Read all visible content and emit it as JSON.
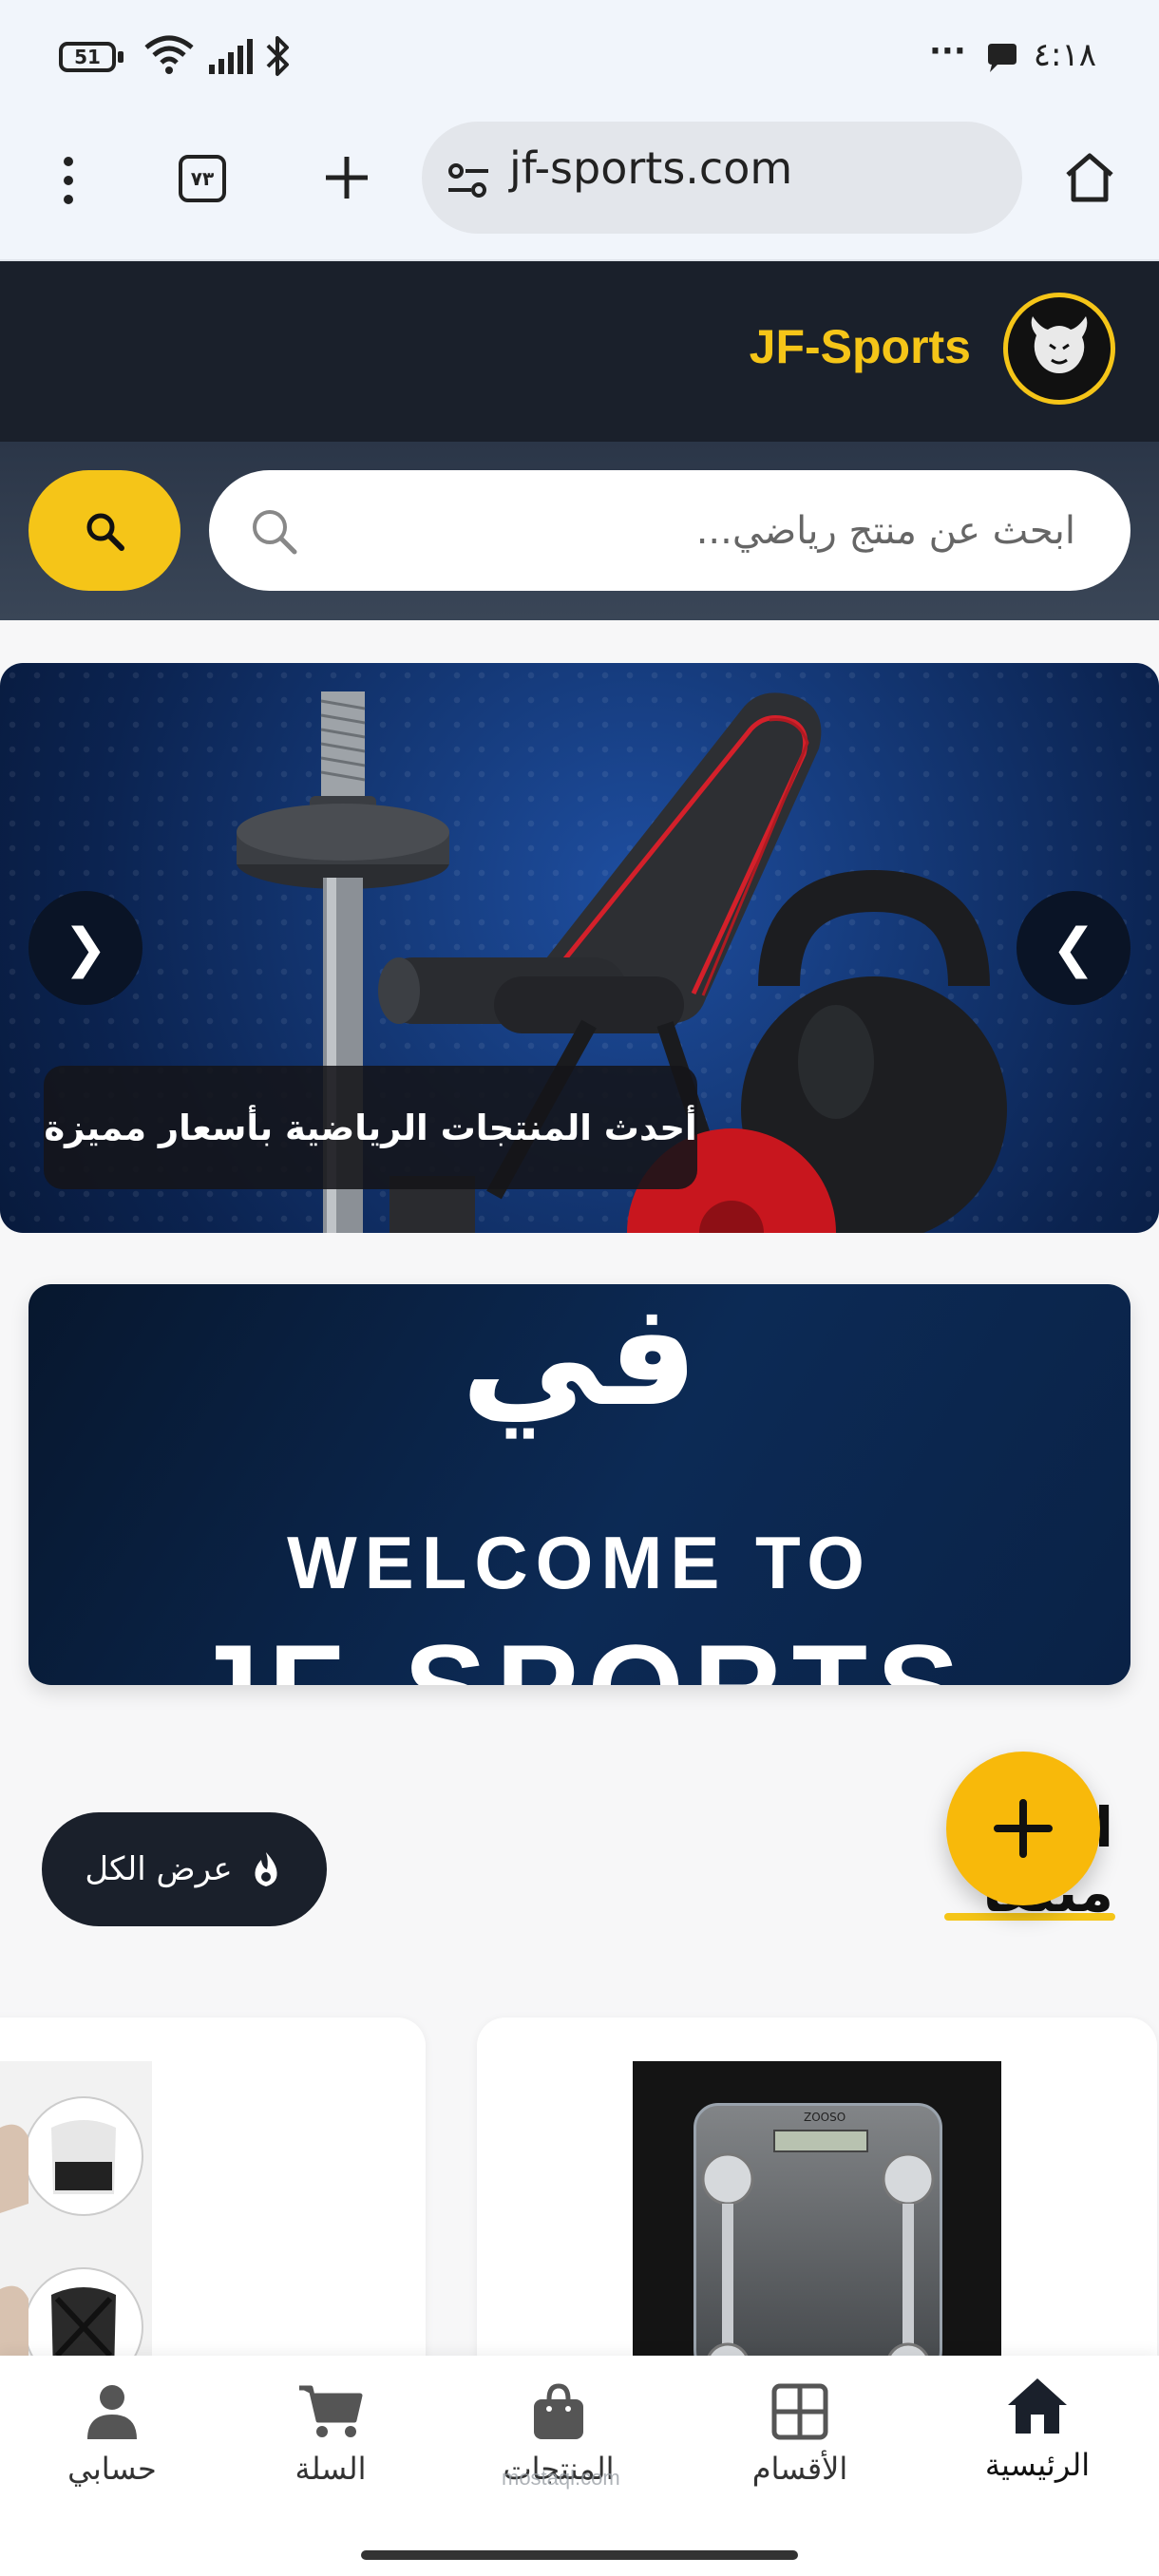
{
  "status_bar": {
    "battery": "51",
    "time": "٤:١٨",
    "dots": "···"
  },
  "browser": {
    "url": "jf-sports.com",
    "tab_count": "٧٣"
  },
  "header": {
    "brand": "JF-Sports"
  },
  "search": {
    "placeholder": "ابحث عن منتج رياضي..."
  },
  "hero": {
    "caption": "أحدث المنتجات الرياضية بأسعار مميزة",
    "prev_arrow": "❮",
    "next_arrow": "❯"
  },
  "welcome": {
    "arabic": "في",
    "line1": "WELCOME TO",
    "line2": "JF-SPORTS"
  },
  "section": {
    "title": "الأكثر مبيعًا",
    "view_all": "عرض الكل"
  },
  "scale_product": {
    "brand": "ZOOSO"
  },
  "bottom_nav": {
    "items": [
      {
        "label": "الرئيسية",
        "icon": "home-icon",
        "active": true
      },
      {
        "label": "الأقسام",
        "icon": "grid-icon",
        "active": false
      },
      {
        "label": "المنتجات",
        "icon": "shopping-bag-icon",
        "active": false
      },
      {
        "label": "السلة",
        "icon": "cart-icon",
        "active": false
      },
      {
        "label": "حسابي",
        "icon": "user-icon",
        "active": false
      }
    ]
  },
  "watermark": {
    "text": "mostaql.com"
  },
  "colors": {
    "accent": "#f5c518",
    "header_bg": "#1a202b",
    "fab": "#f8b90a"
  }
}
